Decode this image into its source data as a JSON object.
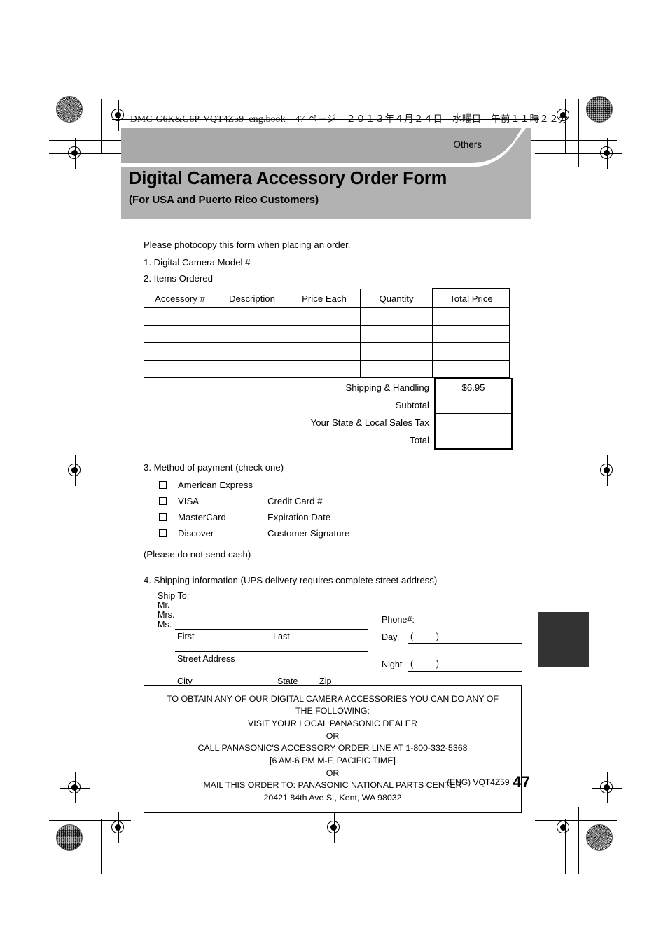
{
  "print_header": {
    "text": "DMC-G6K&G6P-VQT4Z59_eng.book　47 ページ　２０１３年４月２４日　水曜日　午前１１時２２分"
  },
  "banner": {
    "section_label": "Others",
    "title": "Digital Camera Accessory Order Form",
    "subtitle": "(For USA and Puerto Rico Customers)"
  },
  "body": {
    "intro": "Please photocopy this form when placing an order.",
    "step1": "1. Digital Camera Model #",
    "step2": "2. Items Ordered",
    "step3": "3. Method of payment (check one)",
    "step4": "4. Shipping information (UPS delivery requires complete street address)",
    "no_cash_note": "(Please do not send cash)"
  },
  "items_table": {
    "headers": [
      "Accessory #",
      "Description",
      "Price Each",
      "Quantity",
      "Total Price"
    ],
    "rows": [
      [
        "",
        "",
        "",
        "",
        ""
      ],
      [
        "",
        "",
        "",
        "",
        ""
      ],
      [
        "",
        "",
        "",
        "",
        ""
      ],
      [
        "",
        "",
        "",
        "",
        ""
      ]
    ]
  },
  "totals": [
    {
      "label": "Shipping & Handling",
      "value": "$6.95"
    },
    {
      "label": "Subtotal",
      "value": ""
    },
    {
      "label": "Your State & Local Sales Tax",
      "value": ""
    },
    {
      "label": "Total",
      "value": ""
    }
  ],
  "payment": {
    "methods": [
      "American Express",
      "VISA",
      "MasterCard",
      "Discover"
    ],
    "fields": [
      "Credit Card #",
      "Expiration Date",
      "Customer Signature"
    ]
  },
  "shipping": {
    "ship_to": "Ship To:",
    "honorifics": [
      "Mr.",
      "Mrs.",
      "Ms."
    ],
    "caption_first": "First",
    "caption_last": "Last",
    "caption_street": "Street Address",
    "caption_city": "City",
    "caption_state": "State",
    "caption_zip": "Zip",
    "phone_label": "Phone#:",
    "phone_day": "Day",
    "phone_night": "Night",
    "paren_open": "(",
    "paren_close": ")"
  },
  "info_box": {
    "lines": [
      "TO OBTAIN ANY OF OUR DIGITAL CAMERA ACCESSORIES YOU CAN DO ANY OF",
      "THE FOLLOWING:",
      "VISIT YOUR LOCAL PANASONIC DEALER",
      "OR",
      "CALL PANASONIC'S ACCESSORY ORDER LINE AT 1-800-332-5368",
      "[6 AM-6 PM M-F, PACIFIC TIME]",
      "OR",
      "MAIL THIS ORDER TO: PANASONIC NATIONAL PARTS CENTER",
      "20421 84th Ave S., Kent, WA 98032"
    ]
  },
  "footer": {
    "doc_code": "(ENG) VQT4Z59",
    "page_number": "47"
  },
  "colors": {
    "banner_top": "#a9a9a9",
    "banner_main": "#b2b2b2",
    "tab_marker": "#333333",
    "rule": "#000000"
  }
}
